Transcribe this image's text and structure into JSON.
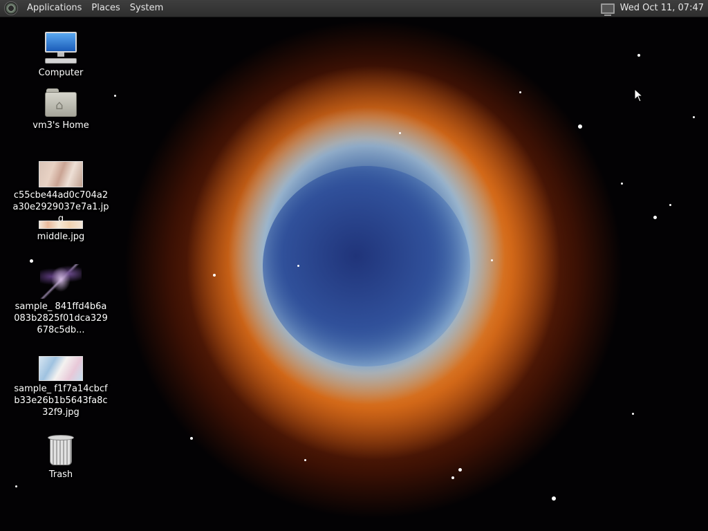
{
  "panel": {
    "menus": [
      "Applications",
      "Places",
      "System"
    ],
    "clock": "Wed Oct 11, 07:47"
  },
  "desktop_icons": [
    {
      "label": "Computer",
      "icon": "computer-icon"
    },
    {
      "label": "vm3's Home",
      "icon": "home-folder-icon"
    },
    {
      "label": "c55cbe44ad0c704a2a30e2929037e7a1.jpg",
      "icon": "image-thumbnail-icon"
    },
    {
      "label": "middle.jpg",
      "icon": "image-thumbnail-icon"
    },
    {
      "label": "sample_ 841ffd4b6a083b2825f01dca329678c5db...",
      "icon": "image-thumbnail-icon"
    },
    {
      "label": "sample_ f1f7a14cbcfb33e26b1b5643fa8c32f9.jpg",
      "icon": "image-thumbnail-icon"
    },
    {
      "label": "Trash",
      "icon": "trash-icon"
    }
  ]
}
